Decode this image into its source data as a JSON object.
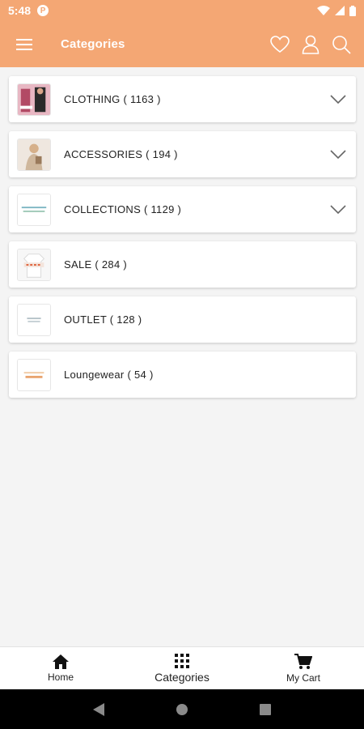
{
  "status_bar": {
    "time": "5:48",
    "app_badge": "P"
  },
  "app_bar": {
    "title": "Categories"
  },
  "categories": [
    {
      "label": "CLOTHING ( 1163 )",
      "has_children": true,
      "thumb": "clothing"
    },
    {
      "label": "ACCESSORIES ( 194 )",
      "has_children": true,
      "thumb": "accessories"
    },
    {
      "label": "COLLECTIONS ( 1129 )",
      "has_children": true,
      "thumb": "collections"
    },
    {
      "label": "SALE ( 284 )",
      "has_children": false,
      "thumb": "sale"
    },
    {
      "label": "OUTLET ( 128 )",
      "has_children": false,
      "thumb": "outlet"
    },
    {
      "label": "Loungewear ( 54 )",
      "has_children": false,
      "thumb": "loungewear"
    }
  ],
  "bottom_nav": {
    "home": "Home",
    "categories": "Categories",
    "cart": "My Cart"
  },
  "theme": {
    "accent": "#f4a774"
  }
}
